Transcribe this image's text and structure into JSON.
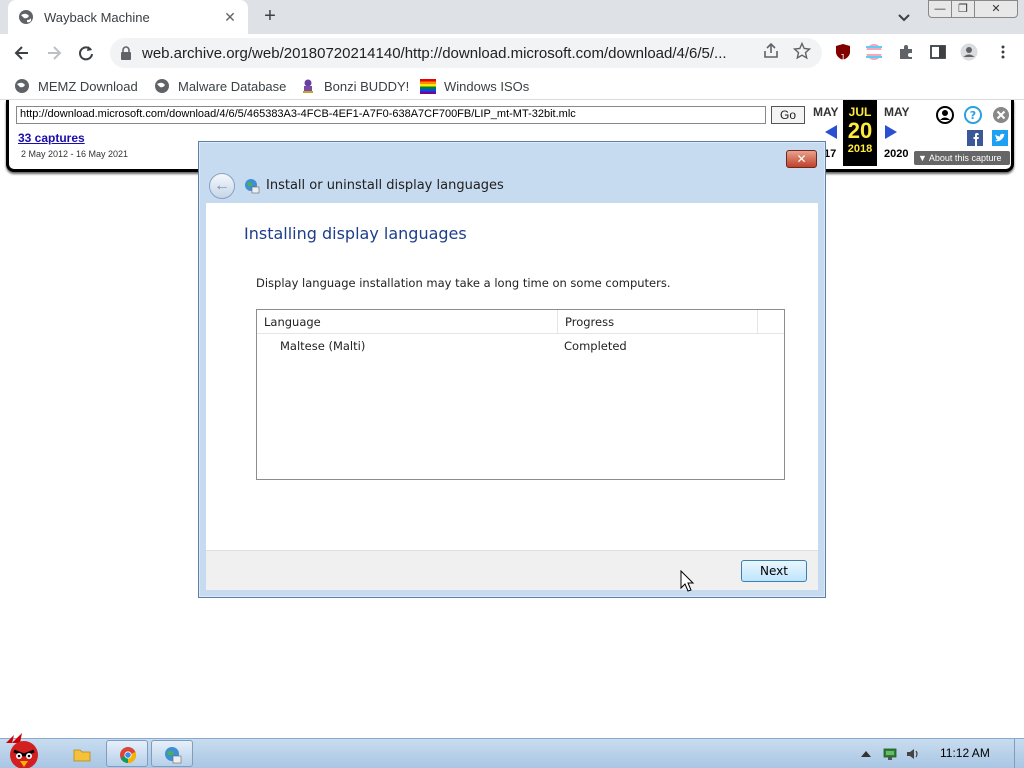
{
  "browser": {
    "tab": {
      "title": "Wayback Machine",
      "close_glyph": "✕"
    },
    "new_tab_glyph": "+",
    "window_controls": {
      "minimize": "—",
      "maximize": "❐",
      "close": "✕"
    },
    "address_bar": {
      "url": "web.archive.org/web/20180720214140/http://download.microsoft.com/download/4/6/5/..."
    },
    "extension_badge": "1",
    "bookmarks": [
      {
        "label": "MEMZ Download",
        "icon": "globe-icon"
      },
      {
        "label": "Malware Database",
        "icon": "globe-icon"
      },
      {
        "label": "Bonzi BUDDY!",
        "icon": "bonzi-icon"
      },
      {
        "label": "Windows ISOs",
        "icon": "windows-flag-icon"
      }
    ]
  },
  "wayback": {
    "url_value": "http://download.microsoft.com/download/4/6/5/465383A3-4FCB-4EF1-A7F0-638A7CF700FB/LIP_mt-MT-32bit.mlc",
    "go_label": "Go",
    "captures": "33 captures",
    "date_range": "2 May 2012 - 16 May 2021",
    "prev_month": "MAY",
    "current_month": "JUL",
    "current_day": "20",
    "current_year": "2018",
    "next_month": "MAY",
    "prev_year_partial": "17",
    "next_year": "2020",
    "about_capture": "▼ About this capture"
  },
  "dialog": {
    "close_glyph": "✕",
    "title": "Install or uninstall display languages",
    "heading": "Installing display languages",
    "description": "Display language installation may take a long time on some computers.",
    "columns": [
      "Language",
      "Progress"
    ],
    "rows": [
      {
        "language": "Maltese (Malti)",
        "progress": "Completed"
      }
    ],
    "next_label": "Next"
  },
  "taskbar": {
    "clock": "11:12 AM"
  },
  "colors": {
    "dialog_frame": "#c6daf0",
    "heading_blue": "#1e3e8c",
    "wayback_yellow": "#ffeb3b",
    "link_blue": "#1a0dab"
  }
}
